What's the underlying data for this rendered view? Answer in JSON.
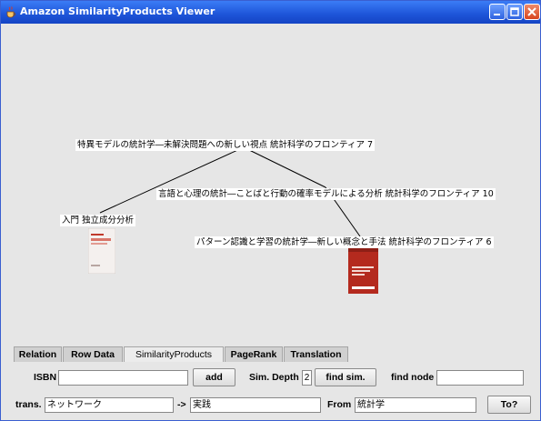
{
  "window": {
    "title": "Amazon SimilarityProducts Viewer"
  },
  "graph": {
    "nodes": [
      {
        "id": "root",
        "label": "特異モデルの統計学―未解決問題への新しい視点 統計科学のフロンティア 7",
        "has_cover": false
      },
      {
        "id": "n1",
        "label": "言語と心理の統計―ことばと行動の確率モデルによる分析  統計科学のフロンティア 10",
        "has_cover": false
      },
      {
        "id": "n2",
        "label": "入門 独立成分分析",
        "has_cover": true
      },
      {
        "id": "n3",
        "label": "パターン認識と学習の統計学―新しい概念と手法  統計科学のフロンティア 6",
        "has_cover": true
      }
    ],
    "edges": [
      [
        "root",
        "n1"
      ],
      [
        "root",
        "n2"
      ],
      [
        "n1",
        "n3"
      ]
    ]
  },
  "tabs": [
    {
      "label": "Relation",
      "active": false
    },
    {
      "label": "Row Data",
      "active": false
    },
    {
      "label": "SimilarityProducts",
      "active": true
    },
    {
      "label": "PageRank",
      "active": false
    },
    {
      "label": "Translation",
      "active": false
    }
  ],
  "controls": {
    "isbn_label": "ISBN",
    "isbn_value": "",
    "add_label": "add",
    "sim_depth_label": "Sim. Depth",
    "sim_depth_value": "2",
    "find_sim_label": "find sim.",
    "find_node_label": "find node",
    "find_node_value": "",
    "trans_label": "trans.",
    "trans_value": "ネットワーク",
    "arrow_label": "->",
    "trans_target_value": "実践",
    "from_label": "From",
    "from_value": "統計学",
    "to_label": "To?"
  },
  "colors": {
    "titlebar": "#1d54d8",
    "background": "#e6e6e6",
    "cover_red": "#b42a1e"
  }
}
